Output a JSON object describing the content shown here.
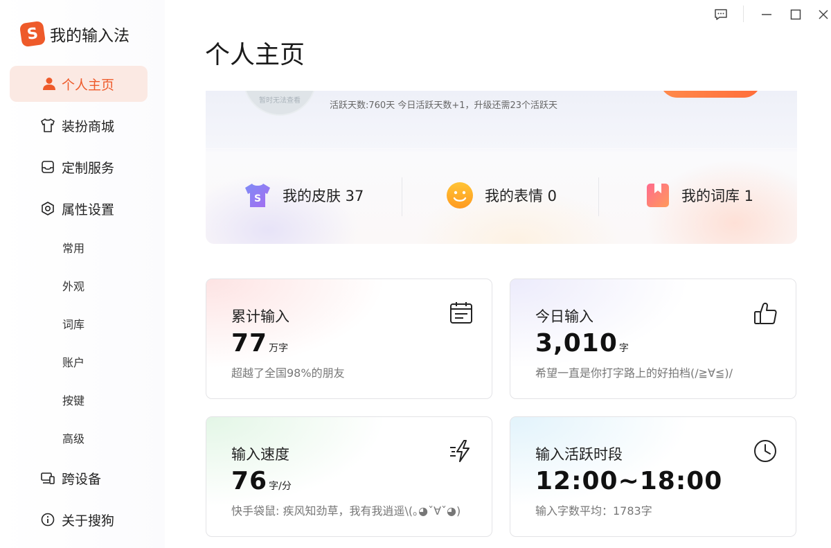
{
  "app": {
    "name": "我的输入法",
    "logo_glyph": "S",
    "accent": "#ee5a2a"
  },
  "sidebar": {
    "items": [
      {
        "label": "个人主页",
        "icon": "user-icon",
        "active": true
      },
      {
        "label": "装扮商城",
        "icon": "tshirt-icon"
      },
      {
        "label": "定制服务",
        "icon": "inbox-icon"
      },
      {
        "label": "属性设置",
        "icon": "hexagon-gear-icon"
      }
    ],
    "sub_items": [
      "常用",
      "外观",
      "词库",
      "账户",
      "按键",
      "高级"
    ],
    "bottom_items": [
      {
        "label": "跨设备",
        "icon": "devices-icon"
      },
      {
        "label": "关于搜狗",
        "icon": "info-icon"
      }
    ]
  },
  "window_controls": [
    "feedback-icon",
    "minimize-icon",
    "maximize-icon",
    "close-icon"
  ],
  "page": {
    "title": "个人主页"
  },
  "profile": {
    "avatar_text": "暂时无法查看",
    "active_days_text": "活跃天数:760天 今日活跃天数+1，升级还需23个活跃天",
    "stats": [
      {
        "label": "我的皮肤 37",
        "icon": "skin-icon"
      },
      {
        "label": "我的表情 0",
        "icon": "smiley-icon"
      },
      {
        "label": "我的词库 1",
        "icon": "dictionary-icon"
      }
    ]
  },
  "cards": [
    {
      "title": "累计输入",
      "value": "77",
      "unit": "万字",
      "desc": "超越了全国98%的朋友",
      "icon": "calendar-icon",
      "tint": "#fde3e3"
    },
    {
      "title": "今日输入",
      "value": "3,010",
      "unit": "字",
      "desc": "希望一直是你打字路上的好拍档(/≧∀≦)/",
      "icon": "thumbs-up-icon",
      "tint": "#ecebfb"
    },
    {
      "title": "输入速度",
      "value": "76",
      "unit": "字/分",
      "desc": "快手袋鼠: 疾风知劲草，我有我逍遥\\(｡◕ˇ∀ˇ◕)",
      "icon": "speed-icon",
      "tint": "#e3f6e6"
    },
    {
      "title": "输入活跃时段",
      "value": "12:00~18:00",
      "unit": "",
      "desc": "输入字数平均：1783字",
      "icon": "clock-icon",
      "tint": "#e2f3fb"
    }
  ]
}
